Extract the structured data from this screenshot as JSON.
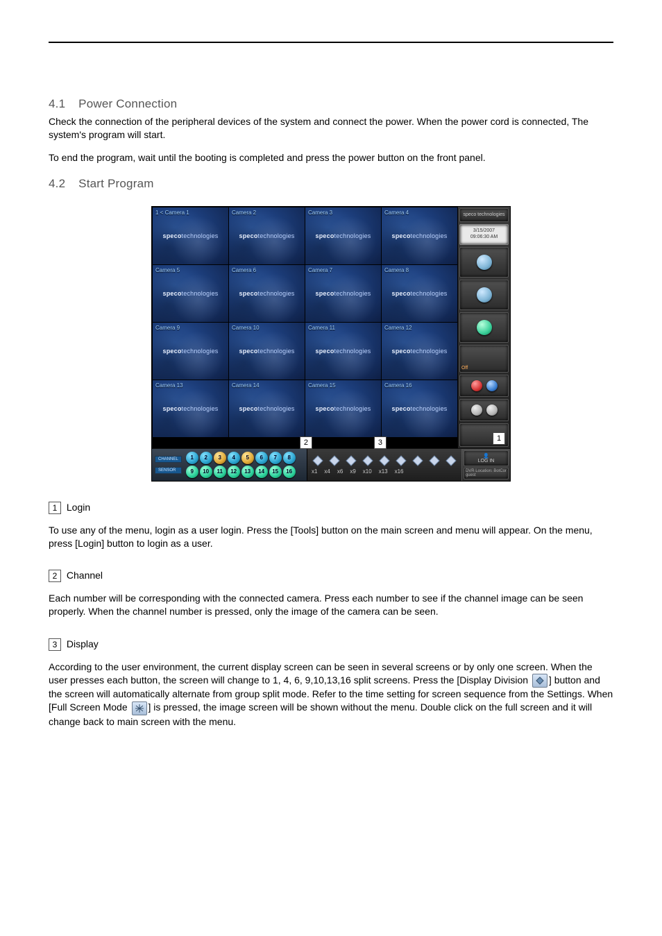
{
  "sections": {
    "power": {
      "number": "4.1",
      "title": "Power Connection"
    },
    "start": {
      "number": "4.2",
      "title": "Start Program"
    }
  },
  "paragraphs": {
    "power_p1": "Check the connection of the peripheral devices of the system and connect the power. When the power cord is connected, The system's program will start.",
    "power_p2": "To end the program, wait until the booting is completed and press the power button on the front panel.",
    "usage_intro": "To use any of the menu, login as a user login. Press the [Tools] button on the main screen and menu will appear. On the menu, press [Login] button to login as a user.",
    "channel_p": "Each number will be corresponding with the connected camera. Press each number to see if the channel image can be seen properly. When the channel number is pressed, only the image of the camera can be seen.",
    "display_p_pre": "According to the user environment, the current display screen can be seen in several screens or by only one screen. When the user presses each button, the screen will change to 1, 4, 6, 9,10,13,16 split screens. Press the [Display Division",
    "display_p_mid_a": "] button and the screen will automatically alternate from group split mode. Refer to the time setting for screen sequence from the Settings. When [Full Screen Mode",
    "display_p_mid_b": "] is pressed, the image screen will be shown without the menu. Double click on the full screen and it will change back to main screen with the menu."
  },
  "callouts": {
    "one": {
      "num": "1",
      "label": "Login"
    },
    "two": {
      "num": "2",
      "label": "Channel"
    },
    "three": {
      "num": "3",
      "label": "Display"
    }
  },
  "surveillance": {
    "brand": "speco technologies",
    "watermark_prefix": "speco",
    "watermark_suffix": "technologies",
    "date": "3/15/2007",
    "time": "09:06:30 AM",
    "ptz_label": "Off",
    "login_button": "LOG IN",
    "dvr_location": "DVR Location: BotCor",
    "user": "guest",
    "cameras": [
      "1 < Camera 1",
      "Camera 2",
      "Camera 3",
      "Camera 4",
      "Camera 5",
      "Camera 6",
      "Camera 7",
      "Camera 8",
      "Camera 9",
      "Camera 10",
      "Camera 11",
      "Camera 12",
      "Camera 13",
      "Camera 14",
      "Camera 15",
      "Camera 16"
    ],
    "channel_label": "CHANNEL",
    "sensor_label": "SENSOR",
    "channel_numbers": [
      "1",
      "2",
      "3",
      "4",
      "5",
      "6",
      "7",
      "8",
      "9",
      "10",
      "11",
      "12",
      "13",
      "14",
      "15",
      "16"
    ],
    "split_labels": [
      "x1",
      "x4",
      "x6",
      "x9",
      "x10",
      "x13",
      "x16"
    ]
  }
}
